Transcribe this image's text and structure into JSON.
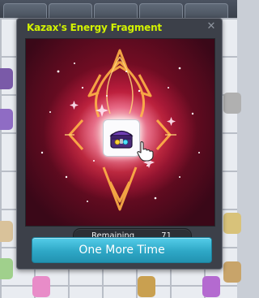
{
  "popup": {
    "title": "Kazax's Energy Fragment",
    "close_icon": "close-icon",
    "item_icon": "treasure-chest-icon",
    "cursor_icon": "hand-pointer-icon",
    "remaining_label": "Remaining",
    "remaining_value": "71",
    "button_label": "One More Time"
  },
  "colors": {
    "title": "#d2f200",
    "button": "#2ea7c6",
    "art_glow": "#a3122b"
  }
}
